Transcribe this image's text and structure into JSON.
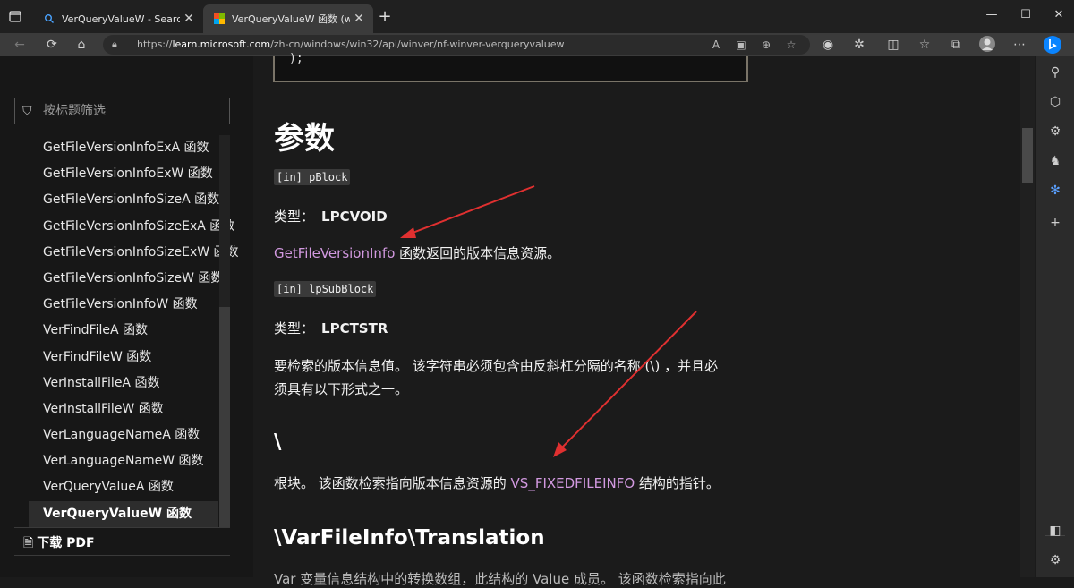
{
  "browser": {
    "tabs": [
      {
        "title": "VerQueryValueW - Search",
        "favicon": "search-icon"
      },
      {
        "title": "VerQueryValueW 函数 (winver.h)",
        "favicon": "microsoft-logo"
      }
    ],
    "url_prefix": "https://",
    "url_domain": "learn.microsoft.com",
    "url_path": "/zh-cn/windows/win32/api/winver/nf-winver-verqueryvaluew"
  },
  "nav": {
    "filter_placeholder": "按标题筛选",
    "items": [
      "GetFileVersionInfoExA 函数",
      "GetFileVersionInfoExW 函数",
      "GetFileVersionInfoSizeA 函数",
      "GetFileVersionInfoSizeExA 函数",
      "GetFileVersionInfoSizeExW 函数",
      "GetFileVersionInfoSizeW 函数",
      "GetFileVersionInfoW 函数",
      "VerFindFileA 函数",
      "VerFindFileW 函数",
      "VerInstallFileA 函数",
      "VerInstallFileW 函数",
      "VerLanguageNameA 函数",
      "VerLanguageNameW 函数",
      "VerQueryValueA 函数",
      "VerQueryValueW 函数"
    ],
    "active_index": 14,
    "download_pdf": "下载 PDF"
  },
  "content": {
    "code_tail": ");",
    "params_heading": "参数",
    "param1_code": "[in] pBlock",
    "param1_type_label": "类型：",
    "param1_type": "LPCVOID",
    "param1_link": "GetFileVersionInfo",
    "param1_desc": " 函数返回的版本信息资源。",
    "param2_code": "[in] lpSubBlock",
    "param2_type_label": "类型：",
    "param2_type": "LPCTSTR",
    "param2_desc_line1": "要检索的版本信息值。 该字符串必须包含由反斜杠分隔的名称 (\\) ，并且必",
    "param2_desc_line2": "须具有以下形式之一。",
    "sub_heading_root": "\\",
    "root_desc_pre": "根块。 该函数检索指向版本信息资源的 ",
    "root_desc_link": "VS_FIXEDFILEINFO",
    "root_desc_post": " 结构的指针。",
    "sub_heading_translation": "\\VarFileInfo\\Translation",
    "translation_desc_partial": "Var 变量信息结构中的转换数组，此结构的 Value 成员。 该函数检索指向此"
  },
  "colors": {
    "link": "#d299e0",
    "annotation_arrow": "#e03030",
    "accent": "#0a84ff"
  }
}
